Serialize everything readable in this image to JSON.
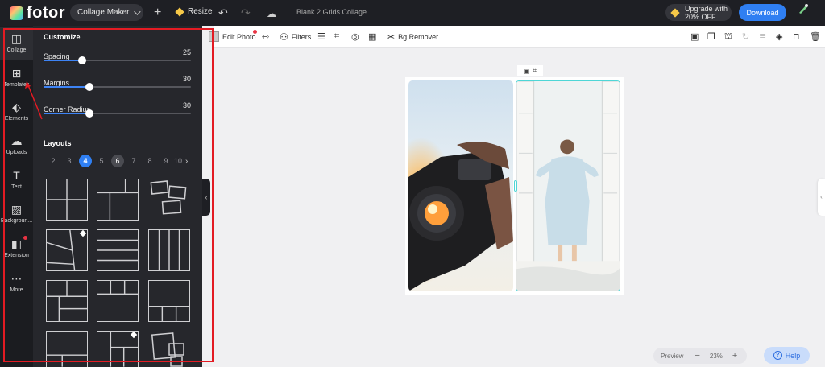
{
  "topbar": {
    "brand": "fotor",
    "mode": "Collage Maker",
    "resize_label": "Resize",
    "document_title": "Blank 2 Grids Collage",
    "upgrade_line1": "Upgrade with",
    "upgrade_line2": "20% OFF",
    "download_label": "Download"
  },
  "toolbar": {
    "edit_photo": "Edit Photo",
    "filters": "Filters",
    "bg_remover": "Bg Remover"
  },
  "rail": {
    "items": [
      {
        "label": "Collage",
        "icon": "collage-icon"
      },
      {
        "label": "Templates",
        "icon": "templates-icon"
      },
      {
        "label": "Elements",
        "icon": "elements-icon"
      },
      {
        "label": "Uploads",
        "icon": "uploads-icon"
      },
      {
        "label": "Text",
        "icon": "text-icon"
      },
      {
        "label": "Backgroun...",
        "icon": "background-icon"
      },
      {
        "label": "Extension",
        "icon": "extension-icon"
      },
      {
        "label": "More",
        "icon": "more-icon"
      }
    ]
  },
  "customize": {
    "title": "Customize",
    "sliders": [
      {
        "name": "Spacing",
        "value": "25",
        "fraction": 0.26
      },
      {
        "name": "Margins",
        "value": "30",
        "fraction": 0.31
      },
      {
        "name": "Corner Radius",
        "value": "30",
        "fraction": 0.31
      }
    ]
  },
  "layouts": {
    "title": "Layouts",
    "counts": [
      "2",
      "3",
      "4",
      "5",
      "6",
      "7",
      "8",
      "9",
      "10"
    ],
    "selected": "4"
  },
  "zoom": {
    "preview": "Preview",
    "minus": "−",
    "percent": "23%",
    "plus": "+"
  },
  "help_label": "Help",
  "colors": {
    "accent": "#2f7ff2",
    "highlight": "#e31b23",
    "selection": "#4ed6d6"
  }
}
